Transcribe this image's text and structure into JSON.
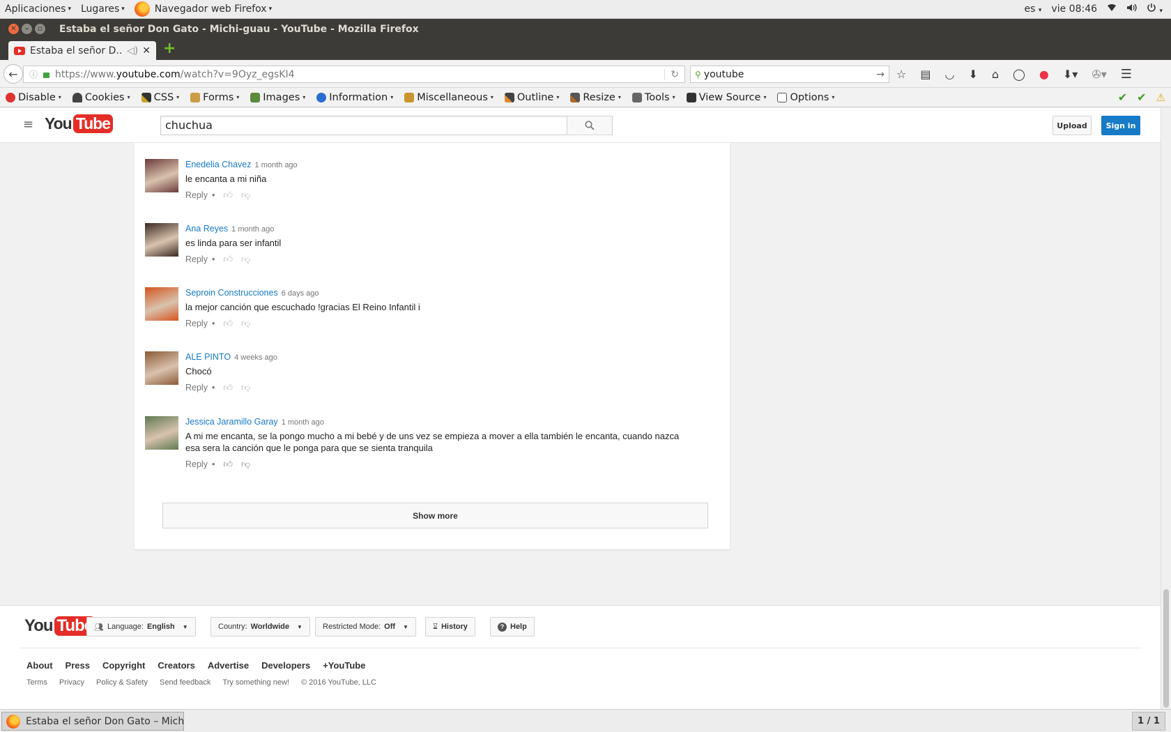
{
  "system_bar": {
    "apps_menu": "Aplicaciones",
    "places_menu": "Lugares",
    "active_app": "Navegador web Firefox",
    "language": "es",
    "clock": "vie 08:46"
  },
  "window": {
    "title": "Estaba el señor Don Gato - Michi-guau - YouTube - Mozilla Firefox"
  },
  "browser": {
    "tab_title": "Estaba el señor D...",
    "url_host": "https://www.",
    "url_domain": "youtube.com",
    "url_rest": "/watch?v=9Oyz_egsKI4",
    "search_value": "youtube"
  },
  "devtoolbar": {
    "items": [
      "Disable",
      "Cookies",
      "CSS",
      "Forms",
      "Images",
      "Information",
      "Miscellaneous",
      "Outline",
      "Resize",
      "Tools",
      "View Source",
      "Options"
    ]
  },
  "youtube": {
    "logo_you": "You",
    "logo_tube": "Tube",
    "search_value": "chuchua",
    "upload_label": "Upload",
    "signin_label": "Sign in"
  },
  "comments": [
    {
      "author": "Enedelia Chavez",
      "time": "1 month ago",
      "text": "le encanta a mi niña",
      "reply": "Reply",
      "avatar_color": "#6b3a3a"
    },
    {
      "author": "Ana Reyes",
      "time": "1 month ago",
      "text": "es linda para ser infantil",
      "reply": "Reply",
      "avatar_color": "#3a2a22"
    },
    {
      "author": "Seproin Construcciones",
      "time": "6 days ago",
      "text": "la mejor canción que escuchado !gracias El Reino Infantil i",
      "reply": "Reply",
      "avatar_color": "#d4551e"
    },
    {
      "author": "ALE PINTO",
      "time": "4 weeks ago",
      "text": "Chocó",
      "reply": "Reply",
      "avatar_color": "#8c5a35"
    },
    {
      "author": "Jessica Jaramillo Garay",
      "time": "1 month ago",
      "text": "A mi me encanta, se la pongo mucho a mi bebé y de uns vez se empieza a mover a ella también le encanta, cuando nazca esa sera la canción que le ponga para que se sienta tranquila",
      "reply": "Reply",
      "avatar_color": "#5d7a52"
    }
  ],
  "show_more_label": "Show more",
  "footer": {
    "language_label": "Language:",
    "language_value": "English",
    "country_label": "Country:",
    "country_value": "Worldwide",
    "restricted_label": "Restricted Mode:",
    "restricted_value": "Off",
    "history_label": "History",
    "help_label": "Help",
    "links_primary": [
      "About",
      "Press",
      "Copyright",
      "Creators",
      "Advertise",
      "Developers",
      "+YouTube"
    ],
    "links_secondary": [
      "Terms",
      "Privacy",
      "Policy & Safety",
      "Send feedback",
      "Try something new!"
    ],
    "copyright": "© 2016 YouTube, LLC"
  },
  "taskbar": {
    "window_label": "Estaba el señor Don Gato – Michi-...",
    "workspace": "1 / 1"
  },
  "colors": {
    "youtube_red": "#e52d27",
    "link_blue": "#167ac6",
    "signin_blue": "#167ac6"
  }
}
